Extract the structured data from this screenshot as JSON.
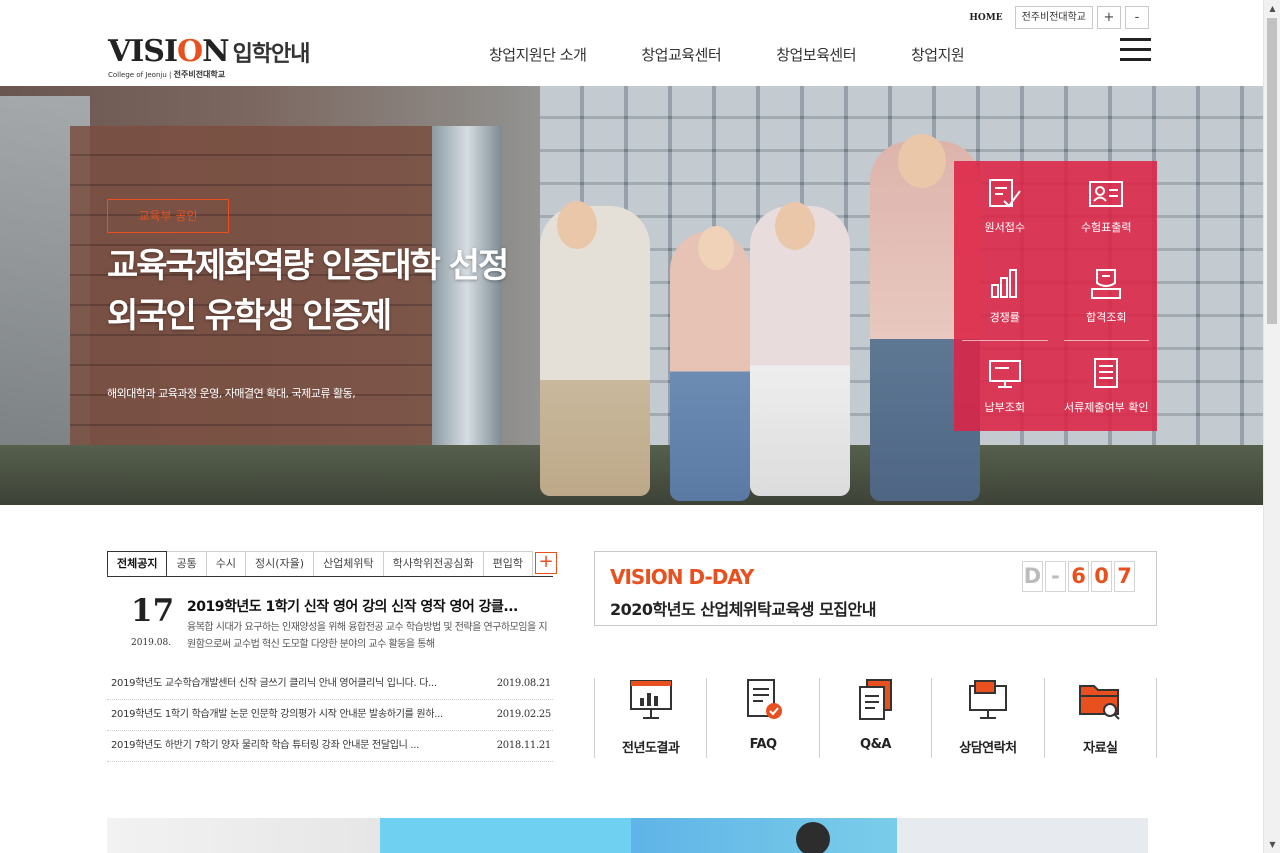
{
  "util": {
    "home": "HOME",
    "univ": "전주비전대학교",
    "zoom_in": "+",
    "zoom_out": "-"
  },
  "logo": {
    "vision_pre": "VISI",
    "vision_o": "O",
    "vision_post": "N",
    "kr": "입학안내",
    "sub_en": "College of Jeonju",
    "sub_kr": "전주비전대학교"
  },
  "gnb": [
    "창업지원단 소개",
    "창업교육센터",
    "창업보육센터",
    "창업지원"
  ],
  "hero": {
    "badge": "교육부 공인",
    "title_line1": "교육국제화역량 인증대학 선정",
    "title_line2": "외국인 유학생 인증제",
    "desc": "해외대학과 교육과정 운영, 자매결연 확대, 국제교류 활동,"
  },
  "quick": [
    {
      "label": "원서접수",
      "icon": "pencil-doc-icon"
    },
    {
      "label": "수험표출력",
      "icon": "id-card-icon"
    },
    {
      "label": "경쟁률",
      "icon": "bar-chart-icon"
    },
    {
      "label": "합격조회",
      "icon": "certificate-icon"
    },
    {
      "label": "납부조회",
      "icon": "monitor-icon"
    },
    {
      "label": "서류제출여부 확인",
      "icon": "document-icon"
    }
  ],
  "notice": {
    "tabs": [
      "전체공지",
      "공통",
      "수시",
      "정시(자율)",
      "산업체위탁",
      "학사학위전공심화",
      "편입학"
    ],
    "more": "+",
    "feature": {
      "day": "17",
      "ym": "2019.08.",
      "title": "2019학년도 1학기 신작 영어 강의 신작 영작 영어 강클...",
      "desc": "융복합 시대가 요구하는 인재양성을 위해 융합전공 교수 학습방법 및 전략을 연구하모임을 지원함으로써 교수법 혁신 도모할 다양한 분야의 교수 활동을 통해"
    },
    "items": [
      {
        "title": "2019학년도 교수학습개발센터 신작 글쓰기 클리닉 안내 영어클리닉 입니다. 다...",
        "date": "2019.08.21"
      },
      {
        "title": "2019학년도 1학기 학습개발 논문 인문학 강의평가 시작 안내문 발송하기를 원하...",
        "date": "2019.02.25"
      },
      {
        "title": "2019학년도 하반기 7학기 양자 물리학 학습 튜터링 강좌 안내문 전달입니 ...",
        "date": "2018.11.21"
      }
    ]
  },
  "dday": {
    "label": "VISION D-DAY",
    "sub": "2020학년도 산업체위탁교육생 모집안내",
    "chars": [
      "D",
      "-",
      "6",
      "0",
      "7"
    ]
  },
  "links": [
    {
      "label": "전년도결과",
      "icon": "presentation-chart-icon"
    },
    {
      "label": "FAQ",
      "icon": "checklist-icon"
    },
    {
      "label": "Q&A",
      "icon": "documents-icon"
    },
    {
      "label": "상담연락처",
      "icon": "computer-chat-icon"
    },
    {
      "label": "자료실",
      "icon": "folder-search-icon"
    }
  ],
  "colors": {
    "accent": "#e8511f",
    "quick_bg": "#dd2346"
  }
}
